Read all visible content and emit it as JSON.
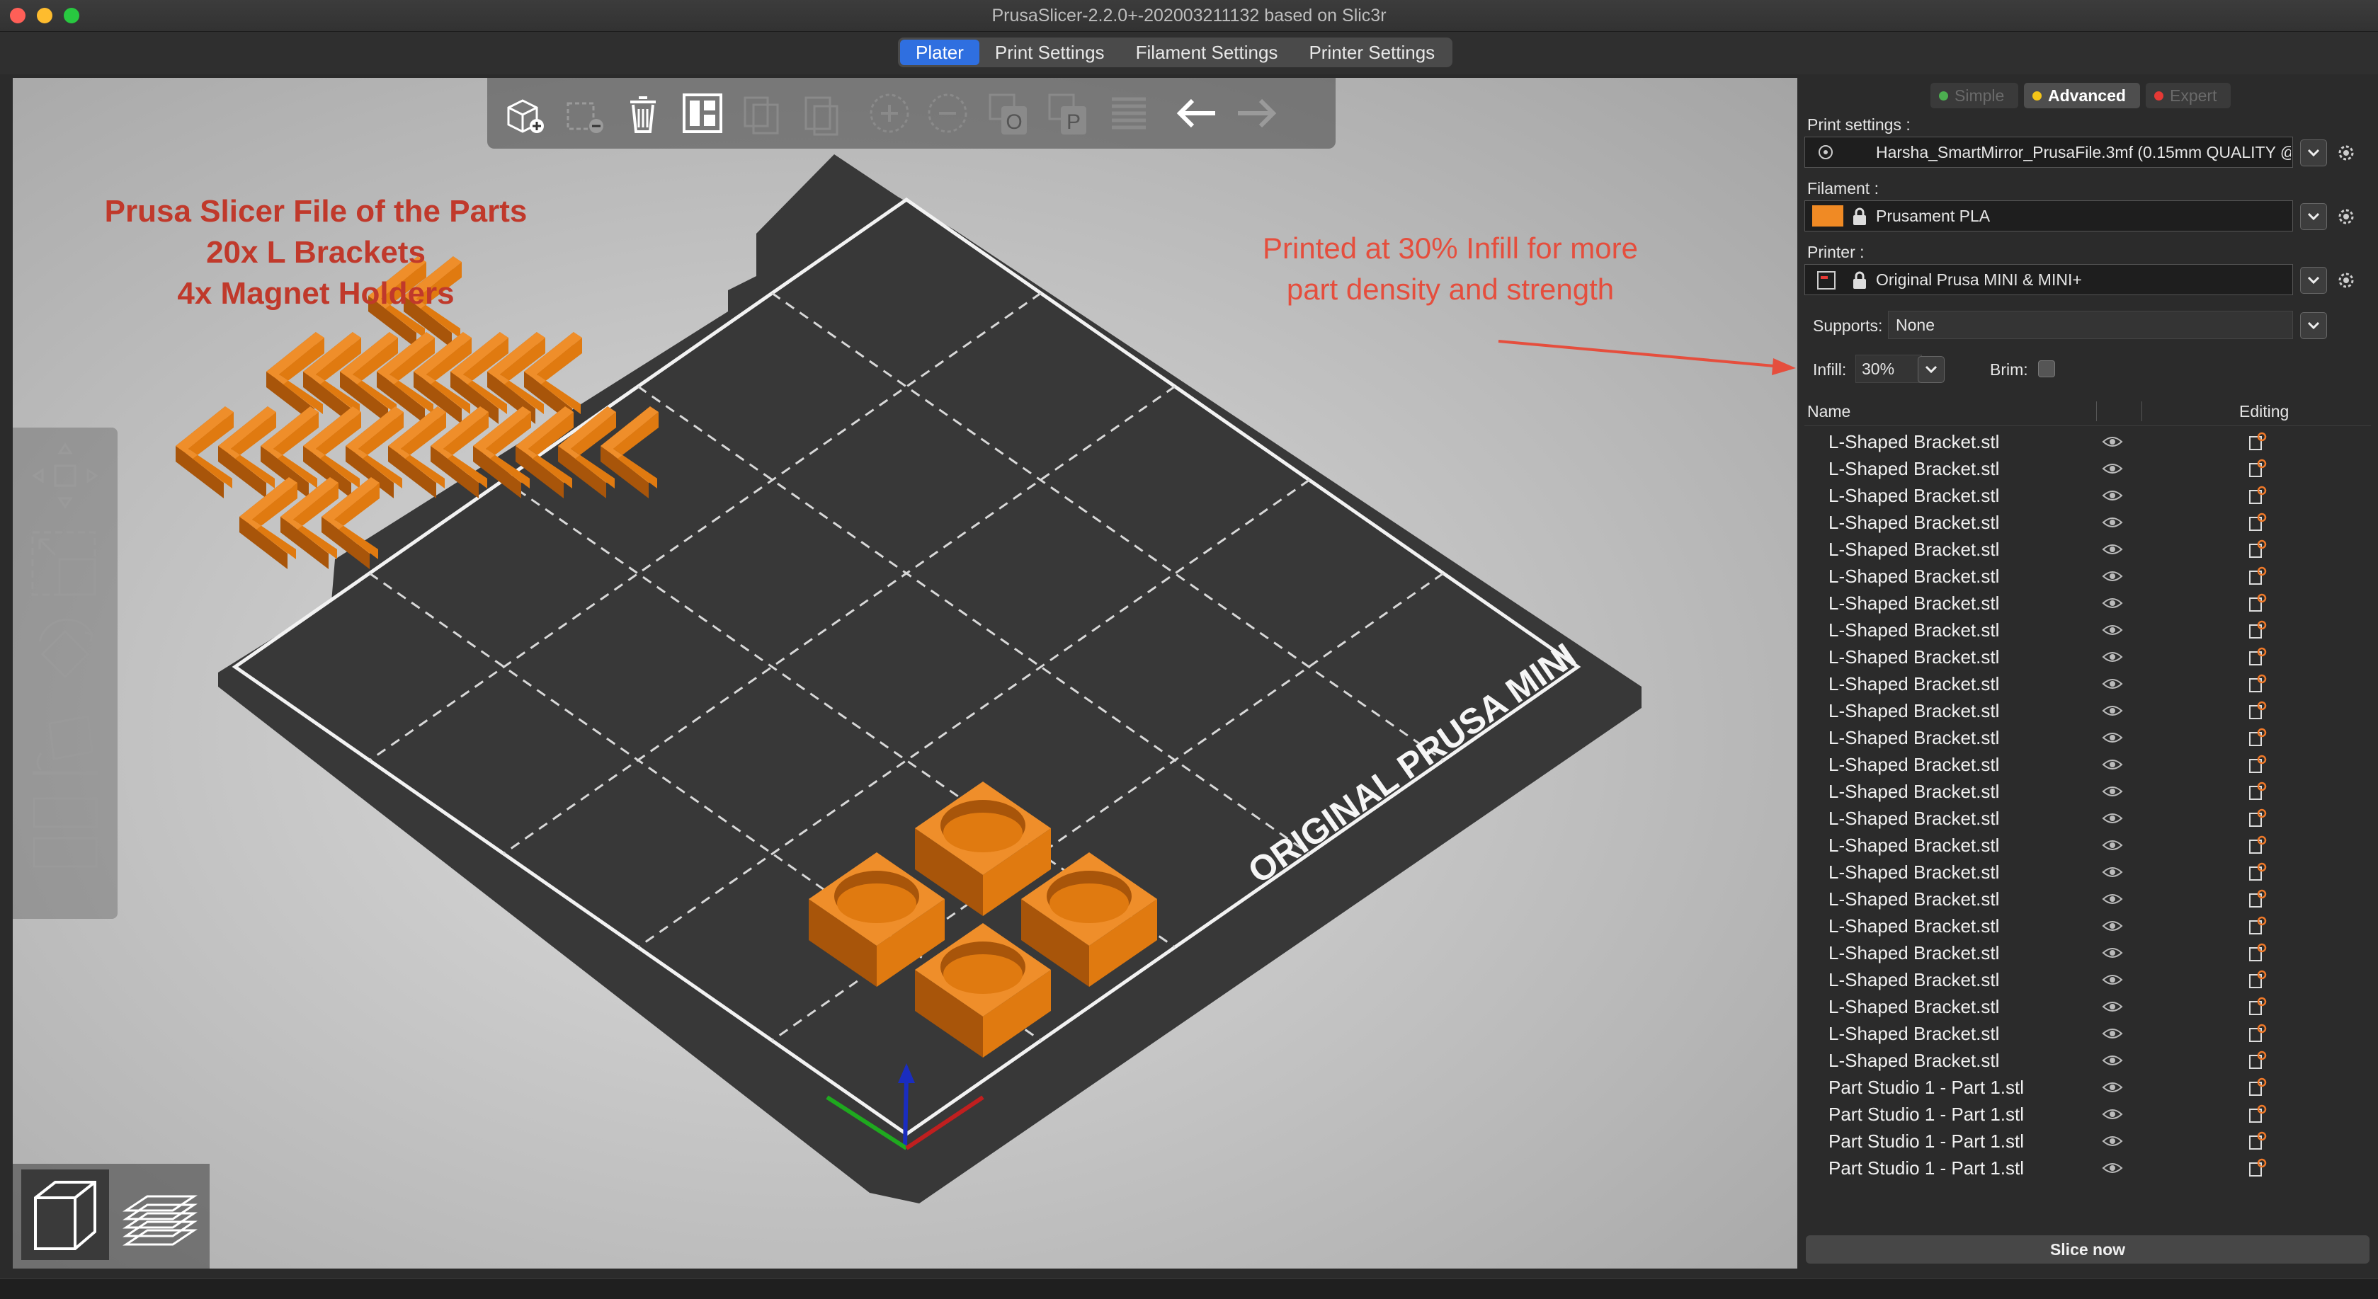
{
  "window": {
    "title": "PrusaSlicer-2.2.0+-202003211132 based on Slic3r",
    "traffic_colors": [
      "#ff5f57",
      "#febc2e",
      "#28c840"
    ]
  },
  "tabs": [
    {
      "label": "Plater",
      "active": true
    },
    {
      "label": "Print Settings",
      "active": false
    },
    {
      "label": "Filament Settings",
      "active": false
    },
    {
      "label": "Printer Settings",
      "active": false
    }
  ],
  "toolbar_icons": [
    "add-object-icon",
    "delete-icon",
    "delete-all-icon",
    "arrange-icon",
    "copy-icon",
    "paste-icon",
    "add-instance-icon",
    "remove-instance-icon",
    "split-objects-icon",
    "split-parts-icon",
    "layers-editing-icon",
    "undo-icon",
    "redo-icon"
  ],
  "gizmo_icons": [
    "move-icon",
    "scale-icon",
    "rotate-icon",
    "place-on-face-icon",
    "cut-icon"
  ],
  "annotations": {
    "parts_line1": "Prusa Slicer File of the Parts",
    "parts_line2": "20x L Brackets",
    "parts_line3": "4x Magnet Holders",
    "infill_line1": "Printed at 30% Infill for more",
    "infill_line2": "part density and strength"
  },
  "bed_label": "ORIGINAL PRUSA MINI",
  "colors": {
    "part": "#e07a10",
    "part_side": "#a8550a",
    "part_top": "#ef8e2a",
    "bed": "#383838",
    "accent": "#2f6fe0",
    "annotation": "#c0392b"
  },
  "panel": {
    "modes": [
      {
        "label": "Simple",
        "dot": "#4caf50",
        "active": false
      },
      {
        "label": "Advanced",
        "dot": "#f5c518",
        "active": true
      },
      {
        "label": "Expert",
        "dot": "#e53935",
        "active": false
      }
    ],
    "print_settings_label": "Print settings :",
    "print_settings_value": "Harsha_SmartMirror_PrusaFile.3mf (0.15mm QUALITY @",
    "filament_label": "Filament :",
    "filament_value": "Prusament PLA",
    "filament_color": "#f08a24",
    "printer_label": "Printer :",
    "printer_value": "Original Prusa MINI & MINI+",
    "supports_label": "Supports:",
    "supports_value": "None",
    "infill_label": "Infill:",
    "infill_value": "30%",
    "brim_label": "Brim:",
    "brim_checked": false,
    "col_name": "Name",
    "col_editing": "Editing",
    "objects": [
      "L-Shaped Bracket.stl",
      "L-Shaped Bracket.stl",
      "L-Shaped Bracket.stl",
      "L-Shaped Bracket.stl",
      "L-Shaped Bracket.stl",
      "L-Shaped Bracket.stl",
      "L-Shaped Bracket.stl",
      "L-Shaped Bracket.stl",
      "L-Shaped Bracket.stl",
      "L-Shaped Bracket.stl",
      "L-Shaped Bracket.stl",
      "L-Shaped Bracket.stl",
      "L-Shaped Bracket.stl",
      "L-Shaped Bracket.stl",
      "L-Shaped Bracket.stl",
      "L-Shaped Bracket.stl",
      "L-Shaped Bracket.stl",
      "L-Shaped Bracket.stl",
      "L-Shaped Bracket.stl",
      "L-Shaped Bracket.stl",
      "L-Shaped Bracket.stl",
      "L-Shaped Bracket.stl",
      "L-Shaped Bracket.stl",
      "L-Shaped Bracket.stl",
      "Part Studio 1 - Part 1.stl",
      "Part Studio 1 - Part 1.stl",
      "Part Studio 1 - Part 1.stl",
      "Part Studio 1 - Part 1.stl"
    ],
    "slice_label": "Slice now"
  }
}
